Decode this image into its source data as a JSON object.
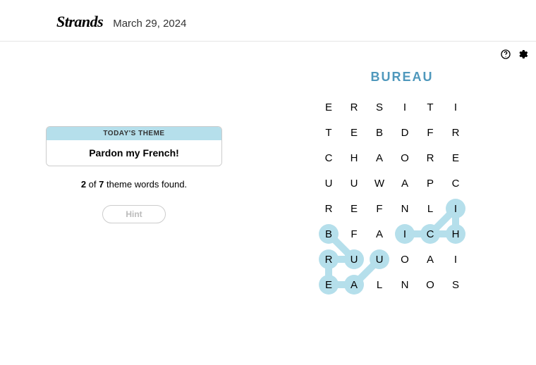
{
  "header": {
    "title": "Strands",
    "date": "March 29, 2024"
  },
  "left": {
    "theme_label": "TODAY'S THEME",
    "theme_text": "Pardon my French!",
    "found": 2,
    "total": 7,
    "progress_mid": " of ",
    "progress_suffix": " theme words found.",
    "hint_label": "Hint"
  },
  "right": {
    "found_word": "BUREAU"
  },
  "grid": {
    "cols": 6,
    "rows": 8,
    "cell": 36,
    "letter_size": 28,
    "letters": [
      [
        "E",
        "R",
        "S",
        "I",
        "T",
        "I"
      ],
      [
        "T",
        "E",
        "B",
        "D",
        "F",
        "R"
      ],
      [
        "C",
        "H",
        "A",
        "O",
        "R",
        "E"
      ],
      [
        "U",
        "U",
        "W",
        "A",
        "P",
        "C"
      ],
      [
        "R",
        "E",
        "F",
        "N",
        "L",
        "I"
      ],
      [
        "B",
        "F",
        "A",
        "I",
        "C",
        "H"
      ],
      [
        "R",
        "U",
        "U",
        "O",
        "A",
        "I"
      ],
      [
        "E",
        "A",
        "L",
        "N",
        "O",
        "S"
      ]
    ],
    "highlights": [
      [
        5,
        3
      ],
      [
        4,
        5
      ],
      [
        5,
        5
      ],
      [
        5,
        4
      ],
      [
        5,
        0
      ],
      [
        6,
        0
      ],
      [
        7,
        0
      ],
      [
        6,
        1
      ],
      [
        7,
        1
      ],
      [
        6,
        2
      ]
    ],
    "lines": [
      [
        [
          5,
          0
        ],
        [
          6,
          1
        ],
        [
          6,
          0
        ],
        [
          7,
          0
        ],
        [
          7,
          1
        ],
        [
          6,
          2
        ]
      ],
      [
        [
          5,
          3
        ],
        [
          5,
          5
        ],
        [
          4,
          5
        ],
        [
          5,
          4
        ]
      ]
    ],
    "hl_color": "#b5dfeb",
    "line_color": "#b5dfeb"
  }
}
